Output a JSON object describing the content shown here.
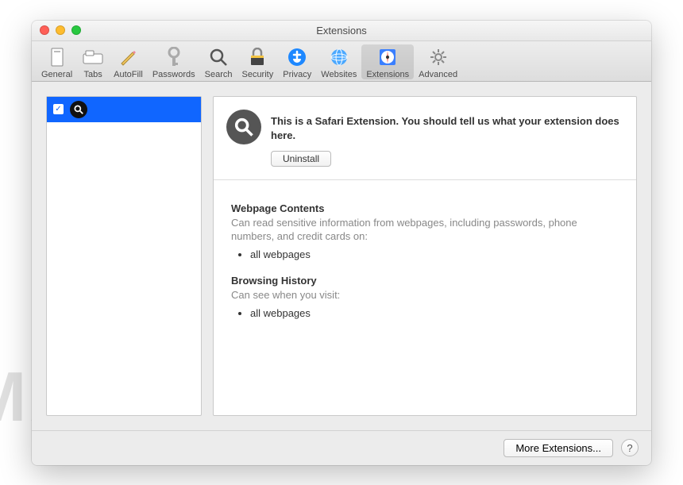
{
  "window": {
    "title": "Extensions"
  },
  "toolbar": {
    "items": [
      {
        "label": "General"
      },
      {
        "label": "Tabs"
      },
      {
        "label": "AutoFill"
      },
      {
        "label": "Passwords"
      },
      {
        "label": "Search"
      },
      {
        "label": "Security"
      },
      {
        "label": "Privacy"
      },
      {
        "label": "Websites"
      },
      {
        "label": "Extensions"
      },
      {
        "label": "Advanced"
      }
    ]
  },
  "detail": {
    "description": "This is a Safari Extension. You should tell us what your extension does here.",
    "uninstall_label": "Uninstall"
  },
  "permissions": {
    "webpage_title": "Webpage Contents",
    "webpage_desc": "Can read sensitive information from webpages, including passwords, phone numbers, and credit cards on:",
    "webpage_item": "all webpages",
    "history_title": "Browsing History",
    "history_desc": "Can see when you visit:",
    "history_item": "all webpages"
  },
  "footer": {
    "more_label": "More Extensions...",
    "help_label": "?"
  },
  "watermark": "MALWARETIPS"
}
